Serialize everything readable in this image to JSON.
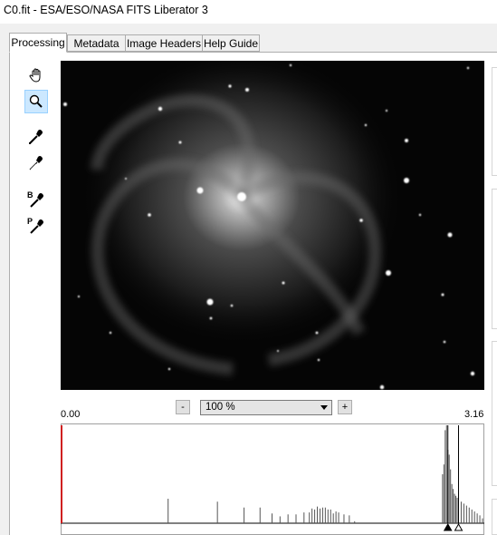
{
  "window": {
    "title": "C0.fit - ESA/ESO/NASA FITS Liberator 3"
  },
  "tabs": [
    {
      "label": "Processing",
      "active": true
    },
    {
      "label": "Metadata",
      "active": false
    },
    {
      "label": "Image Headers",
      "active": false
    },
    {
      "label": "Help Guide",
      "active": false
    }
  ],
  "tools": {
    "hand": "hand-icon",
    "zoom": "magnifier-icon",
    "eyedropper_dark": "eyedropper-black-icon",
    "eyedropper_light": "eyedropper-white-icon",
    "black_point_label": "B",
    "peak_label": "P"
  },
  "zoom": {
    "minus": "-",
    "value": "100 %",
    "plus": "+"
  },
  "histogram": {
    "min_label": "0.00",
    "max_label": "3.16",
    "colors": {
      "bars": "#555555",
      "min_marker": "#d02020"
    }
  },
  "chart_data": {
    "type": "bar",
    "xlim": [
      0.0,
      3.16
    ],
    "x": [
      0.0,
      0.8,
      1.17,
      1.37,
      1.49,
      1.58,
      1.64,
      1.7,
      1.76,
      1.82,
      1.86,
      1.88,
      1.9,
      1.92,
      1.94,
      1.96,
      1.98,
      2.0,
      2.02,
      2.04,
      2.06,
      2.08,
      2.12,
      2.16,
      2.2,
      2.86,
      2.87,
      2.88,
      2.89,
      2.9,
      2.91,
      2.92,
      2.93,
      2.94,
      2.95,
      2.96,
      2.97,
      2.98,
      3.0,
      3.02,
      3.04,
      3.06,
      3.08,
      3.1,
      3.12,
      3.14,
      3.16
    ],
    "values": [
      100,
      25,
      22,
      16,
      16,
      10,
      7,
      9,
      9,
      11,
      11,
      15,
      14,
      17,
      15,
      16,
      16,
      14,
      14,
      10,
      12,
      11,
      9,
      8,
      2,
      50,
      60,
      95,
      100,
      75,
      70,
      55,
      40,
      35,
      30,
      28,
      26,
      24,
      22,
      20,
      18,
      16,
      14,
      12,
      10,
      8,
      5
    ],
    "markers": {
      "black_point": 2.9,
      "white_point": 2.98
    }
  }
}
